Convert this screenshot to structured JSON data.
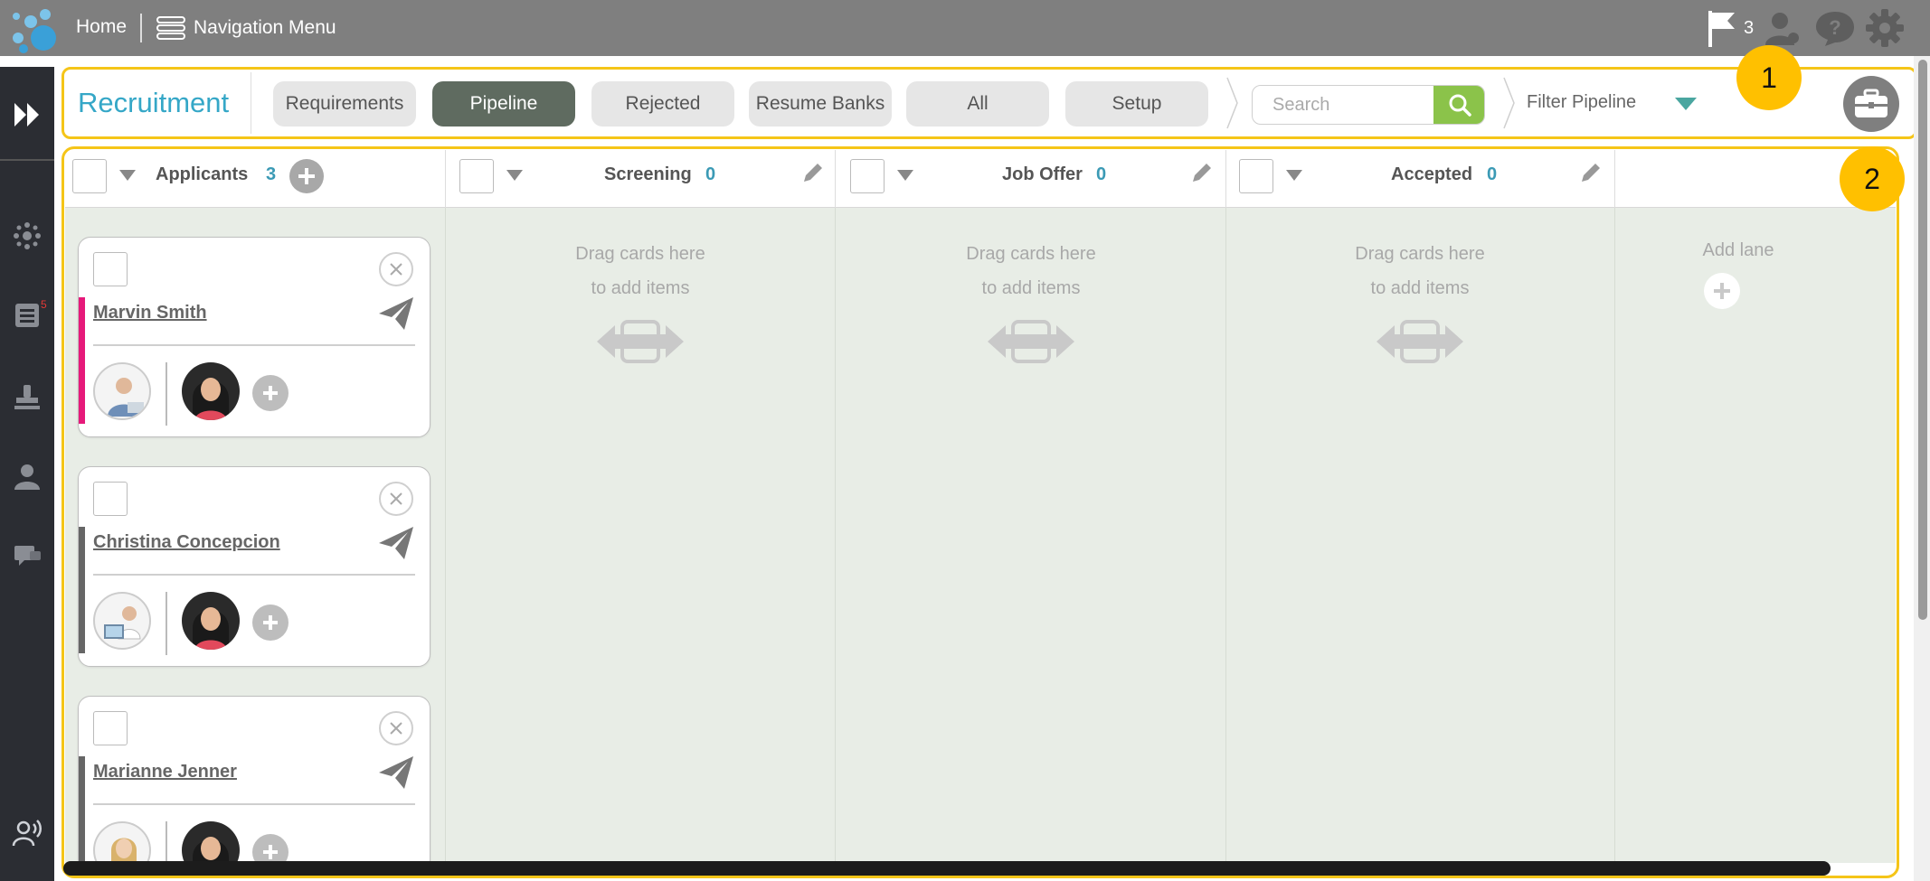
{
  "topbar": {
    "home_label": "Home",
    "nav_label": "Navigation Menu",
    "flag_count": "3"
  },
  "sidebar": {
    "notification_count": "5"
  },
  "toolbar": {
    "title": "Recruitment",
    "tabs": [
      {
        "label": "Requirements",
        "active": false
      },
      {
        "label": "Pipeline",
        "active": true
      },
      {
        "label": "Rejected",
        "active": false
      },
      {
        "label": "Resume Banks",
        "active": false
      },
      {
        "label": "All",
        "active": false
      },
      {
        "label": "Setup",
        "active": false
      }
    ],
    "search_placeholder": "Search",
    "filter_label": "Filter Pipeline"
  },
  "callouts": {
    "one": "1",
    "two": "2"
  },
  "lanes": [
    {
      "name": "Applicants",
      "count": "3"
    },
    {
      "name": "Screening",
      "count": "0"
    },
    {
      "name": "Job Offer",
      "count": "0"
    },
    {
      "name": "Accepted",
      "count": "0"
    }
  ],
  "empty_lane": {
    "line1": "Drag cards here",
    "line2": "to add items"
  },
  "add_lane_label": "Add lane",
  "cards": [
    {
      "name": "Marvin Smith",
      "accent": "#e6197a"
    },
    {
      "name": "Christina Concepcion",
      "accent": "#666666"
    },
    {
      "name": "Marianne Jenner",
      "accent": "#666666"
    }
  ],
  "colors": {
    "topbar": "#7f7f7f",
    "sidebar": "#2b2d33",
    "title": "#35a7c7",
    "active_tab": "#5f6b60",
    "search_button": "#8bc34a",
    "highlight": "#f5c518",
    "callout": "#ffc000",
    "lane_bg": "#e8ede6",
    "count": "#3b9ab5"
  },
  "icons": [
    "app-logo-icon",
    "menu-icon",
    "flag-icon",
    "user-icon",
    "help-icon",
    "gear-icon",
    "expand-icon",
    "network-icon",
    "list-icon",
    "stamp-icon",
    "person-icon",
    "chat-icon",
    "support-icon",
    "search-icon",
    "caret-down-icon",
    "briefcase-icon",
    "plus-icon",
    "edit-icon",
    "drag-icon",
    "close-icon",
    "send-icon"
  ]
}
